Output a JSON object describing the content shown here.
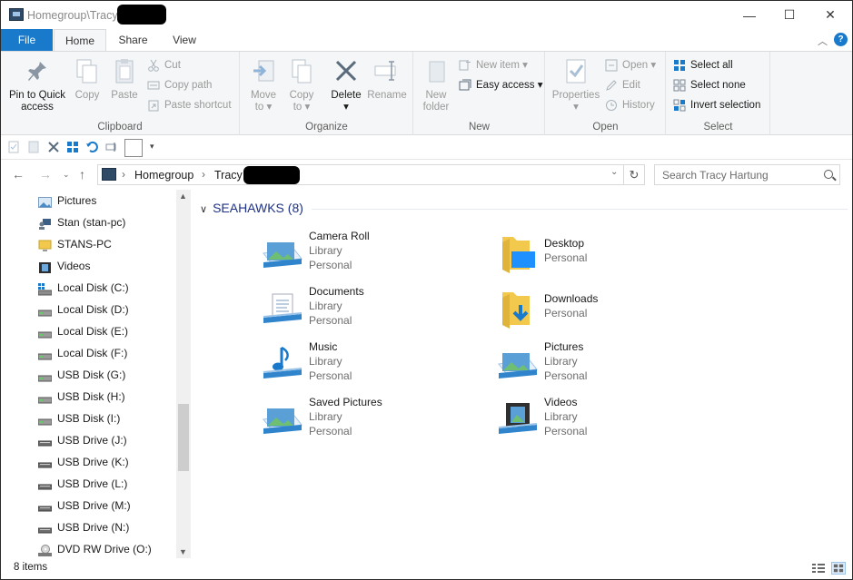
{
  "window": {
    "title": "Homegroup\\Tracy",
    "minimize_glyph": "—",
    "maximize_glyph": "☐",
    "close_glyph": "✕"
  },
  "ribbon_tabs": {
    "file": "File",
    "home": "Home",
    "share": "Share",
    "view": "View",
    "help": "?"
  },
  "clipboard": {
    "label": "Clipboard",
    "pin_line1": "Pin to Quick",
    "pin_line2": "access",
    "copy": "Copy",
    "paste": "Paste",
    "cut": "Cut",
    "copy_path": "Copy path",
    "paste_shortcut": "Paste shortcut"
  },
  "organize": {
    "label": "Organize",
    "move_line1": "Move",
    "move_line2": "to ▾",
    "copy_line1": "Copy",
    "copy_line2": "to ▾",
    "delete_line1": "Delete",
    "delete_line2": "▾",
    "rename": "Rename"
  },
  "new_group": {
    "label": "New",
    "new_folder_line1": "New",
    "new_folder_line2": "folder",
    "new_item": "New item ▾",
    "easy_access": "Easy access ▾"
  },
  "open_group": {
    "label": "Open",
    "properties_line1": "Properties",
    "properties_line2": "▾",
    "open": "Open ▾",
    "edit": "Edit",
    "history": "History"
  },
  "select_group": {
    "label": "Select",
    "select_all": "Select all",
    "select_none": "Select none",
    "invert_selection": "Invert selection"
  },
  "address": {
    "crumbs": [
      "Homegroup",
      "Tracy"
    ],
    "search_placeholder": "Search Tracy Hartung"
  },
  "nav_pane": {
    "items": [
      {
        "label": "Pictures",
        "icon": "pictures-icon"
      },
      {
        "label": "Stan (stan-pc)",
        "icon": "user-pc-icon"
      },
      {
        "label": "STANS-PC",
        "icon": "computer-icon"
      },
      {
        "label": "Videos",
        "icon": "videos-icon"
      },
      {
        "label": "Local Disk (C:)",
        "icon": "system-drive-icon"
      },
      {
        "label": "Local Disk  (D:)",
        "icon": "drive-icon"
      },
      {
        "label": "Local Disk (E:)",
        "icon": "drive-icon"
      },
      {
        "label": "Local Disk (F:)",
        "icon": "drive-icon"
      },
      {
        "label": "USB Disk (G:)",
        "icon": "drive-icon"
      },
      {
        "label": "USB Disk (H:)",
        "icon": "drive-icon"
      },
      {
        "label": "USB Disk (I:)",
        "icon": "drive-icon"
      },
      {
        "label": "USB Drive (J:)",
        "icon": "usb-drive-icon"
      },
      {
        "label": "USB Drive (K:)",
        "icon": "usb-drive-icon"
      },
      {
        "label": "USB Drive (L:)",
        "icon": "usb-drive-icon"
      },
      {
        "label": "USB Drive (M:)",
        "icon": "usb-drive-icon"
      },
      {
        "label": "USB Drive (N:)",
        "icon": "usb-drive-icon"
      },
      {
        "label": "DVD RW Drive (O:)",
        "icon": "dvd-drive-icon"
      }
    ]
  },
  "content": {
    "group_header": "SEAHAWKS (8)",
    "tiles": [
      {
        "name": "Camera Roll",
        "lines": [
          "Library",
          "Personal"
        ],
        "icon": "library-pictures-icon"
      },
      {
        "name": "Desktop",
        "lines": [
          "Personal"
        ],
        "icon": "desktop-folder-icon"
      },
      {
        "name": "Documents",
        "lines": [
          "Library",
          "Personal"
        ],
        "icon": "library-documents-icon"
      },
      {
        "name": "Downloads",
        "lines": [
          "Personal"
        ],
        "icon": "downloads-folder-icon"
      },
      {
        "name": "Music",
        "lines": [
          "Library",
          "Personal"
        ],
        "icon": "library-music-icon"
      },
      {
        "name": "Pictures",
        "lines": [
          "Library",
          "Personal"
        ],
        "icon": "library-pictures-icon"
      },
      {
        "name": "Saved Pictures",
        "lines": [
          "Library",
          "Personal"
        ],
        "icon": "library-pictures-icon"
      },
      {
        "name": "Videos",
        "lines": [
          "Library",
          "Personal"
        ],
        "icon": "library-videos-icon"
      }
    ]
  },
  "status_bar": {
    "item_count": "8 items"
  },
  "colors": {
    "accent": "#1979ca",
    "group_header": "#1e3287",
    "ribbon_bg": "#f5f6f7",
    "disabled_text": "#9a9a9a"
  }
}
